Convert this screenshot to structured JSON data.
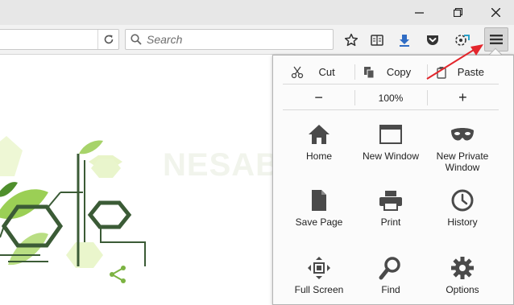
{
  "window": {
    "controls": {
      "minimize_icon": "minimize-icon",
      "restore_icon": "restore-icon",
      "close_icon": "close-icon"
    }
  },
  "toolbar": {
    "reload_icon": "reload-icon",
    "search_placeholder": "Search",
    "icons": [
      "star-icon",
      "reading-list-icon",
      "downloads-icon",
      "pocket-icon",
      "addon-icon",
      "hamburger-menu-icon"
    ]
  },
  "menu": {
    "edit": {
      "cut": "Cut",
      "copy": "Copy",
      "paste": "Paste"
    },
    "zoom": {
      "out": "−",
      "level": "100%",
      "in": "+"
    },
    "items": [
      {
        "label": "Home",
        "icon": "home-icon"
      },
      {
        "label": "New Window",
        "icon": "new-window-icon"
      },
      {
        "label": "New Private\nWindow",
        "icon": "private-mask-icon"
      },
      {
        "label": "Save Page",
        "icon": "save-page-icon"
      },
      {
        "label": "Print",
        "icon": "print-icon"
      },
      {
        "label": "History",
        "icon": "history-icon"
      },
      {
        "label": "Full Screen",
        "icon": "fullscreen-icon"
      },
      {
        "label": "Find",
        "icon": "find-icon"
      },
      {
        "label": "Options",
        "icon": "options-gear-icon"
      }
    ]
  },
  "watermark": "NESABAMEDIA",
  "colors": {
    "annotation_arrow": "#e3262c",
    "icon_gray": "#4a4a4a",
    "leaf_green": "#8cc63f",
    "hex_dark": "#3b5b36"
  }
}
